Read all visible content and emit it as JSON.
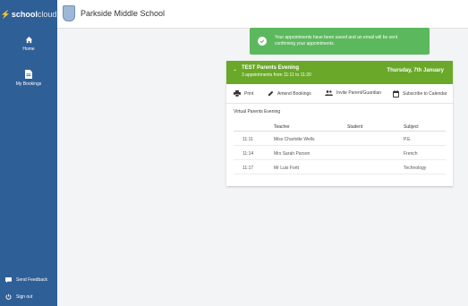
{
  "app": {
    "brand_bolt": "⚡",
    "brand_school": "school",
    "brand_cloud": "cloud",
    "school_name": "Parkside Middle School"
  },
  "sidebar": {
    "items": [
      {
        "label": "Home",
        "icon": "home-icon"
      },
      {
        "label": "My Bookings",
        "icon": "document-icon"
      }
    ],
    "bottom": [
      {
        "label": "Send Feedback",
        "icon": "feedback-icon"
      },
      {
        "label": "Sign out",
        "icon": "power-icon"
      }
    ]
  },
  "toast": {
    "message": "Your appointments have been saved and an email will be sent confirming your appointments.",
    "color": "#5cb85c"
  },
  "event": {
    "title": "TEST Parents Evening",
    "subtitle": "3 appointments from 11:11 to 11:20",
    "date": "Thursday, 7th January",
    "color": "#6aa829"
  },
  "toolbar": {
    "print": "Print",
    "amend": "Amend Bookings",
    "invite": "Invite Parent/Guardian",
    "subscribe": "Subscribe to Calendar"
  },
  "section_label": "Virtual Parents Evening",
  "table": {
    "headers": {
      "time": "",
      "teacher": "Teacher",
      "student": "Student",
      "subject": "Subject"
    },
    "rows": [
      {
        "time": "11:11",
        "teacher": "Miss Charlotte Wells",
        "student": "",
        "subject": "P.E."
      },
      {
        "time": "11:14",
        "teacher": "Mrs Sarah Parson",
        "student": "",
        "subject": "French"
      },
      {
        "time": "11:17",
        "teacher": "Mr Luis Fortt",
        "student": "",
        "subject": "Technology"
      }
    ]
  },
  "colors": {
    "sidebar": "#2f5f97",
    "background": "#f3f4f6"
  }
}
